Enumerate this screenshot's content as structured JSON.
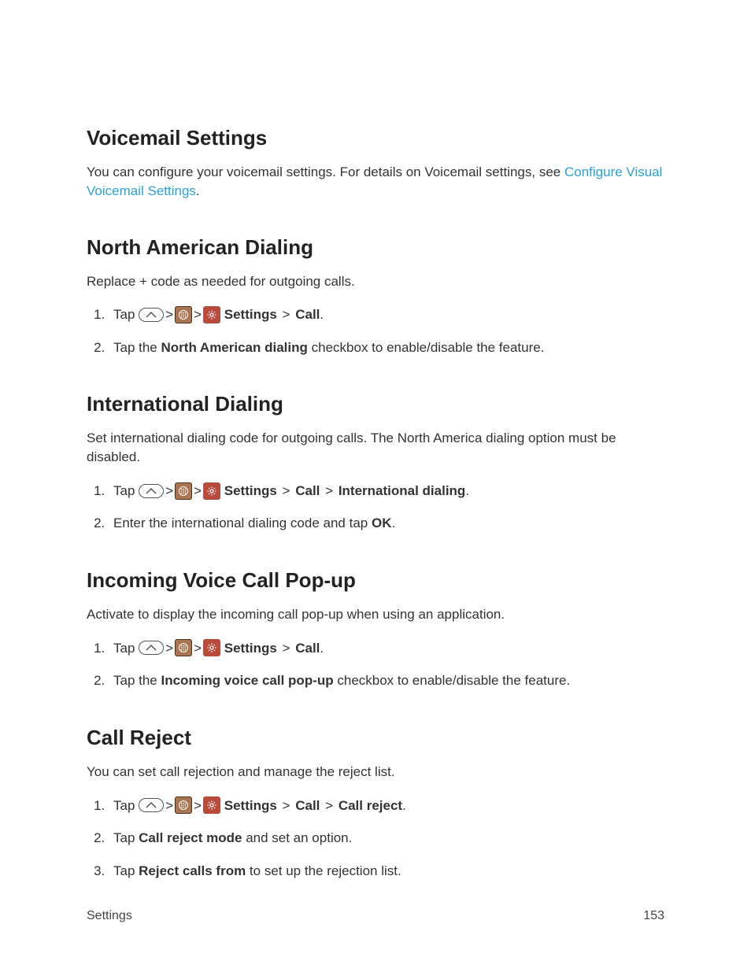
{
  "sections": {
    "voicemail": {
      "heading": "Voicemail Settings",
      "intro_pre": "You can configure your voicemail settings. For details on Voicemail settings, see ",
      "intro_link": "Configure Visual Voicemail Settings",
      "intro_post": "."
    },
    "nad": {
      "heading": "North American Dialing",
      "intro": "Replace + code as needed for outgoing calls.",
      "step1_tap": "Tap ",
      "step1_settings": " Settings",
      "step1_call": "Call",
      "step1_period": ".",
      "step2_pre": "Tap the ",
      "step2_bold": "North American dialing",
      "step2_post": " checkbox to enable/disable the feature."
    },
    "intd": {
      "heading": "International Dialing",
      "intro": "Set international dialing code for outgoing calls. The North America dialing option must be disabled.",
      "step1_tap": "Tap ",
      "step1_settings": " Settings",
      "step1_call": "Call",
      "step1_intl": "International dialing",
      "step1_period": ".",
      "step2_pre": "Enter the international dialing code and tap ",
      "step2_bold": "OK",
      "step2_post": "."
    },
    "popup": {
      "heading": "Incoming Voice Call Pop-up",
      "intro": "Activate to display the incoming call pop-up when using an application.",
      "step1_tap": "Tap ",
      "step1_settings": " Settings",
      "step1_call": "Call",
      "step1_period": ".",
      "step2_pre": "Tap the ",
      "step2_bold": "Incoming voice call pop-up",
      "step2_post": " checkbox to enable/disable the feature."
    },
    "reject": {
      "heading": "Call Reject",
      "intro": "You can set call rejection and manage the reject list.",
      "step1_tap": "Tap ",
      "step1_settings": " Settings",
      "step1_call": "Call",
      "step1_reject": "Call reject",
      "step1_period": ".",
      "step2_pre": "Tap ",
      "step2_bold": "Call reject mode",
      "step2_post": " and set an option.",
      "step3_pre": "Tap ",
      "step3_bold": "Reject calls from",
      "step3_post": " to set up the rejection list."
    }
  },
  "glyphs": {
    "gt": ">"
  },
  "footer": {
    "left": "Settings",
    "right": "153"
  }
}
